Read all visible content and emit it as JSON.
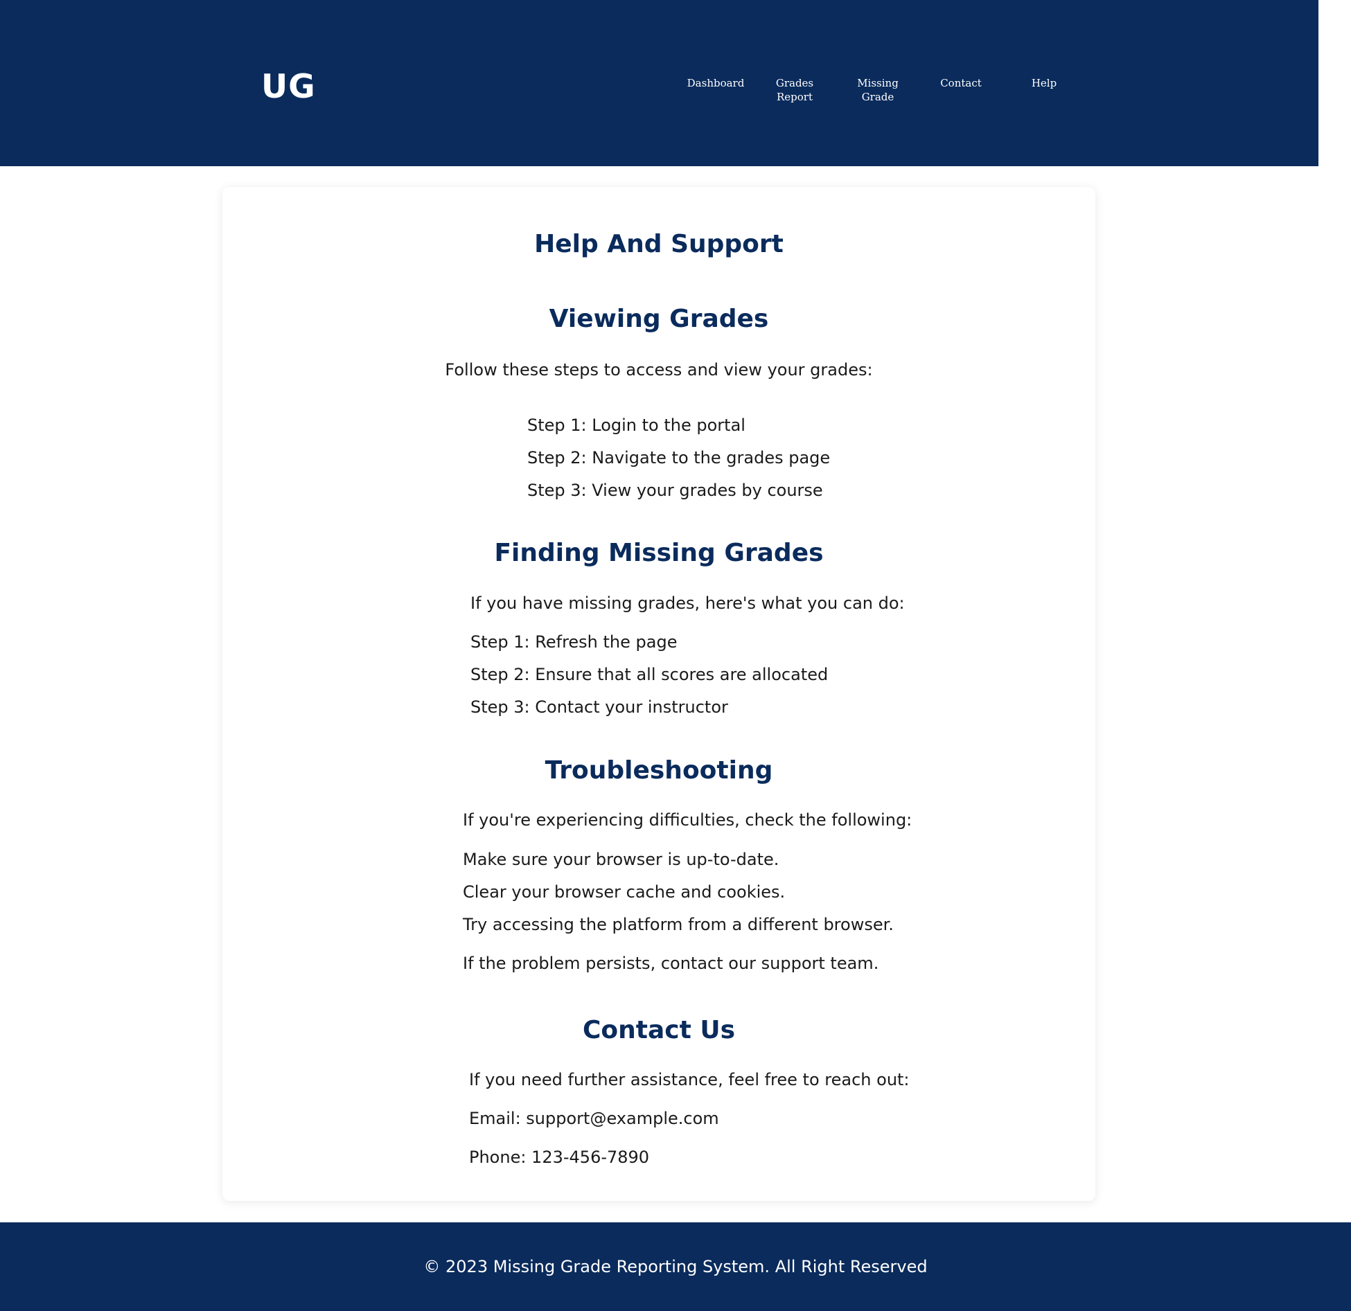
{
  "header": {
    "logo": "UG",
    "nav": {
      "dashboard": "Dashboard",
      "grades_report_1": "Grades",
      "grades_report_2": "Report",
      "missing_grade_1": "Missing",
      "missing_grade_2": "Grade",
      "contact": "Contact",
      "help": "Help"
    }
  },
  "main": {
    "title": "Help And Support",
    "viewing": {
      "heading": "Viewing Grades",
      "intro": "Follow these steps to access and view your grades:",
      "steps": [
        "Step 1: Login to the portal",
        "Step 2: Navigate to the grades page",
        "Step 3: View your grades by course"
      ]
    },
    "missing": {
      "heading": "Finding Missing Grades",
      "intro": "If you have missing grades, here's what you can do:",
      "steps": [
        "Step 1: Refresh the page",
        "Step 2: Ensure that all scores are allocated",
        "Step 3: Contact your instructor"
      ]
    },
    "troubleshooting": {
      "heading": "Troubleshooting",
      "intro": "If you're experiencing difficulties, check the following:",
      "items": [
        "Make sure your browser is up-to-date.",
        "Clear your browser cache and cookies.",
        "Try accessing the platform from a different browser."
      ],
      "outro": "If the problem persists, contact our support team."
    },
    "contact": {
      "heading": "Contact Us",
      "intro": "If you need further assistance, feel free to reach out:",
      "email": "Email: support@example.com",
      "phone": "Phone: 123-456-7890"
    }
  },
  "footer": {
    "text": "© 2023 Missing Grade Reporting System. All Right Reserved"
  },
  "colors": {
    "brand": "#0a2b5c",
    "text": "#1a1a1a",
    "background": "#ffffff"
  }
}
